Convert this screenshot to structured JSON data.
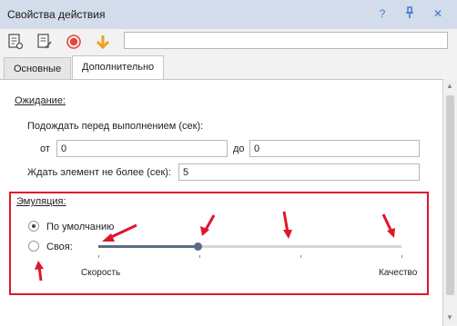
{
  "window": {
    "title": "Свойства действия"
  },
  "titlebar_icons": {
    "help": "?",
    "pin": "pin-icon",
    "close": "✕"
  },
  "toolbar": {
    "tools": [
      "properties-icon",
      "notes-icon",
      "record-icon",
      "arrow-down-icon"
    ],
    "input_value": ""
  },
  "tabs": [
    {
      "label": "Основные",
      "active": false
    },
    {
      "label": "Дополнительно",
      "active": true
    }
  ],
  "wait": {
    "heading": "Ожидание:",
    "before_label": "Подождать перед выполнением (сек):",
    "from_label": "от",
    "from_value": "0",
    "to_label": "до",
    "to_value": "0",
    "element_label": "Ждать элемент не более (сек):",
    "element_value": "5"
  },
  "emulation": {
    "heading": "Эмуляция:",
    "options": [
      {
        "label": "По умолчанию",
        "selected": true
      },
      {
        "label": "Своя:",
        "selected": false
      }
    ],
    "slider": {
      "min_label": "Скорость",
      "max_label": "Качество",
      "position": 0.33,
      "ticks": 4
    }
  },
  "colors": {
    "accent": "#3f78c6",
    "annotation": "#e0162b",
    "record": "#e8453c",
    "arrow": "#f0a020"
  }
}
